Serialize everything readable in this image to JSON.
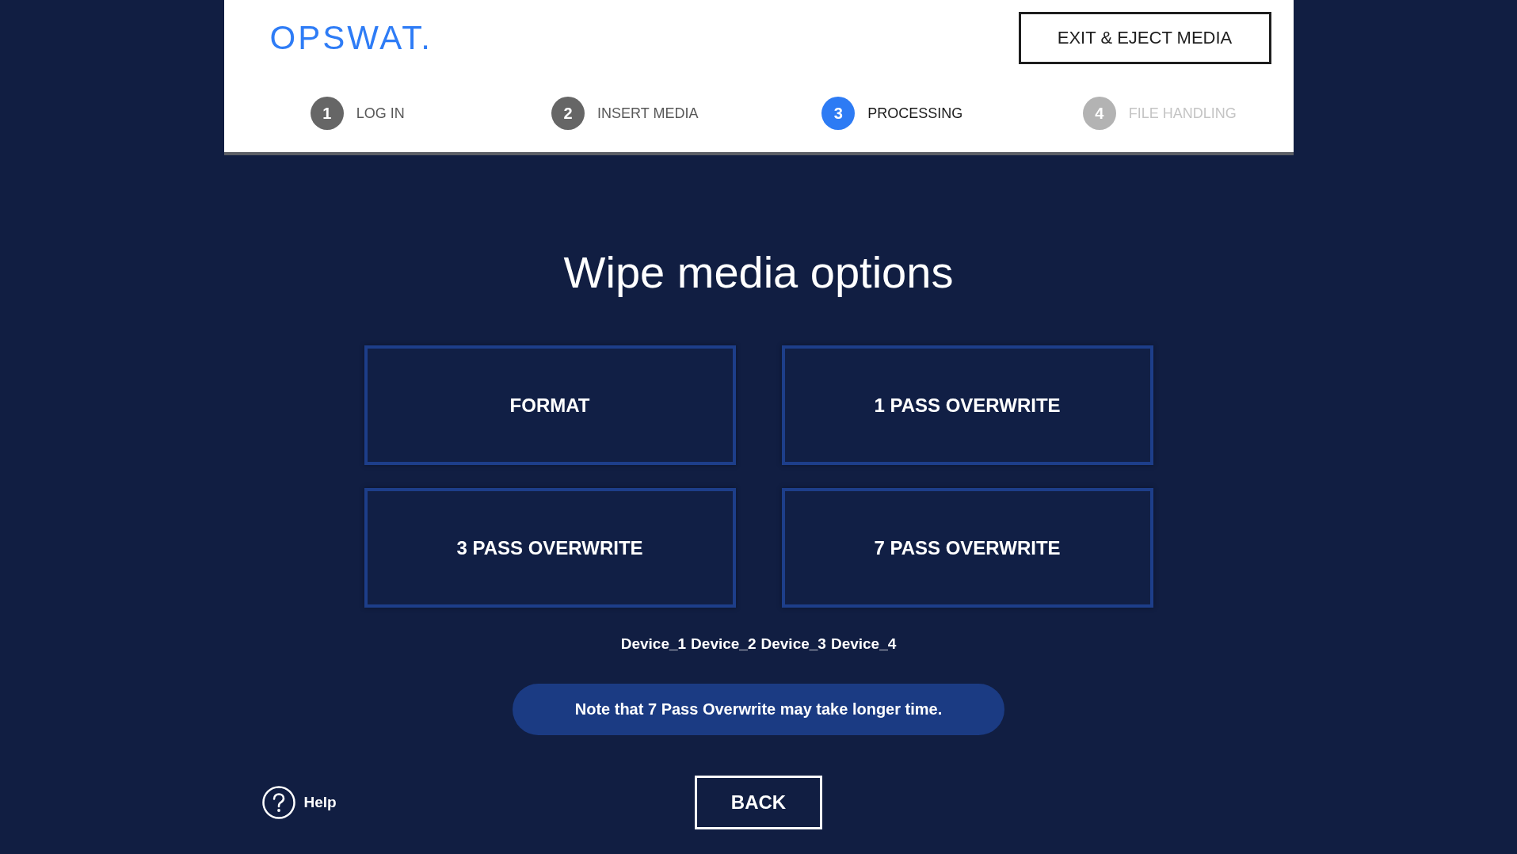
{
  "header": {
    "logo": "OPSWAT.",
    "exit_button": "EXIT & EJECT MEDIA"
  },
  "steps": [
    {
      "number": "1",
      "label": "LOG IN",
      "completed": true,
      "selected": false
    },
    {
      "number": "2",
      "label": "INSERT MEDIA",
      "completed": true,
      "selected": false
    },
    {
      "number": "3",
      "label": "PROCESSING",
      "completed": false,
      "selected": true
    },
    {
      "number": "4",
      "label": "FILE HANDLING",
      "completed": false,
      "selected": false
    }
  ],
  "title": "Wipe media options",
  "options": [
    "FORMAT",
    "1 PASS OVERWRITE",
    "3 PASS OVERWRITE",
    "7 PASS OVERWRITE"
  ],
  "devices": [
    "Device_1",
    "Device_2",
    "Device_3",
    "Device_4"
  ],
  "note": "Note that 7 Pass Overwrite may take longer time.",
  "help": {
    "label": "Help"
  },
  "back_button": "BACK"
}
